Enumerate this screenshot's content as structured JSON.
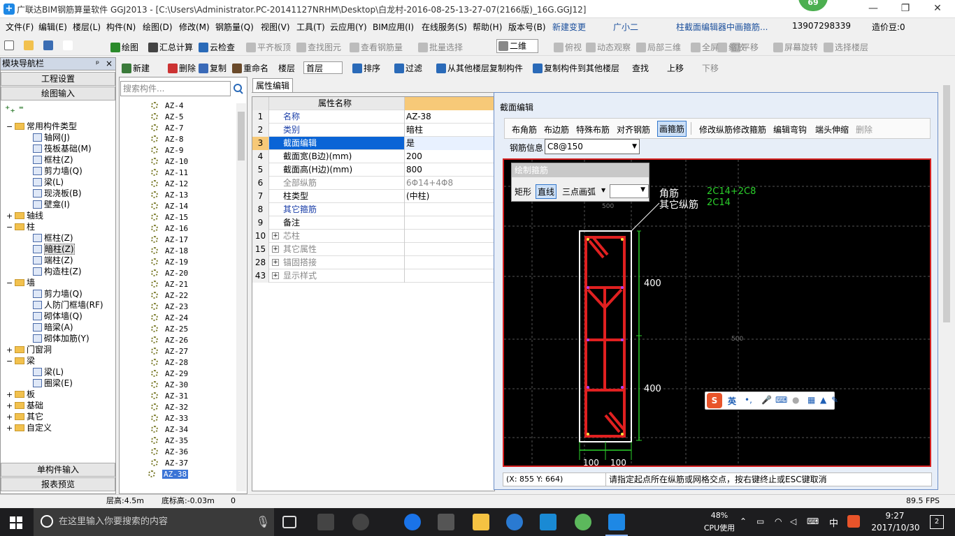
{
  "app": {
    "title": "广联达BIM钢筋算量软件 GGJ2013 - [C:\\Users\\Administrator.PC-20141127NRHM\\Desktop\\白龙村-2016-08-25-13-27-07(2166版)_16G.GGJ12]",
    "badge": "69"
  },
  "menu": {
    "items": [
      "文件(F)",
      "编辑(E)",
      "楼层(L)",
      "构件(N)",
      "绘图(D)",
      "修改(M)",
      "钢筋量(Q)",
      "视图(V)",
      "工具(T)",
      "云应用(Y)",
      "BIM应用(I)",
      "在线服务(S)",
      "帮助(H)",
      "版本号(B)",
      "新建变更",
      "广小二",
      "柱截面编辑器中画箍筋...",
      "13907298339",
      "造价豆:0"
    ]
  },
  "toolbar1": {
    "items": [
      "绘图",
      "汇总计算",
      "云检查",
      "平齐板顶",
      "查找图元",
      "查看钢筋量",
      "批量选择",
      "二维",
      "俯视",
      "动态观察",
      "局部三维",
      "全屏",
      "缩放",
      "平移",
      "屏幕旋转",
      "选择楼层"
    ]
  },
  "toolbar2": {
    "items": [
      "新建",
      "删除",
      "复制",
      "重命名",
      "楼层",
      "首层",
      "排序",
      "过滤",
      "从其他楼层复制构件",
      "复制构件到其他楼层",
      "查找",
      "上移",
      "下移"
    ]
  },
  "leftnav": {
    "header": "模块导航栏",
    "pin": "ᵖ",
    "close": "×",
    "btn_project": "工程设置",
    "btn_draw": "绘图输入",
    "btn_single": "单构件输入",
    "btn_report": "报表预览",
    "tree": [
      {
        "label": "常用构件类型",
        "level": 0,
        "type": "folder",
        "exp": "−"
      },
      {
        "label": "轴网(J)",
        "level": 1,
        "type": "item"
      },
      {
        "label": "筏板基础(M)",
        "level": 1,
        "type": "item"
      },
      {
        "label": "框柱(Z)",
        "level": 1,
        "type": "item"
      },
      {
        "label": "剪力墙(Q)",
        "level": 1,
        "type": "item"
      },
      {
        "label": "梁(L)",
        "level": 1,
        "type": "item"
      },
      {
        "label": "现浇板(B)",
        "level": 1,
        "type": "item"
      },
      {
        "label": "壁龛(I)",
        "level": 1,
        "type": "item"
      },
      {
        "label": "轴线",
        "level": 0,
        "type": "folder",
        "exp": "+"
      },
      {
        "label": "柱",
        "level": 0,
        "type": "folder",
        "exp": "−"
      },
      {
        "label": "框柱(Z)",
        "level": 1,
        "type": "item"
      },
      {
        "label": "暗柱(Z)",
        "level": 1,
        "type": "item"
      },
      {
        "label": "端柱(Z)",
        "level": 1,
        "type": "item"
      },
      {
        "label": "构造柱(Z)",
        "level": 1,
        "type": "item"
      },
      {
        "label": "墙",
        "level": 0,
        "type": "folder",
        "exp": "−"
      },
      {
        "label": "剪力墙(Q)",
        "level": 1,
        "type": "item"
      },
      {
        "label": "人防门框墙(RF)",
        "level": 1,
        "type": "item"
      },
      {
        "label": "砌体墙(Q)",
        "level": 1,
        "type": "item"
      },
      {
        "label": "暗梁(A)",
        "level": 1,
        "type": "item"
      },
      {
        "label": "砌体加筋(Y)",
        "level": 1,
        "type": "item"
      },
      {
        "label": "门窗洞",
        "level": 0,
        "type": "folder",
        "exp": "+"
      },
      {
        "label": "梁",
        "level": 0,
        "type": "folder",
        "exp": "−"
      },
      {
        "label": "梁(L)",
        "level": 1,
        "type": "item"
      },
      {
        "label": "圈梁(E)",
        "level": 1,
        "type": "item"
      },
      {
        "label": "板",
        "level": 0,
        "type": "folder",
        "exp": "+"
      },
      {
        "label": "基础",
        "level": 0,
        "type": "folder",
        "exp": "+"
      },
      {
        "label": "其它",
        "level": 0,
        "type": "folder",
        "exp": "+"
      },
      {
        "label": "自定义",
        "level": 0,
        "type": "folder",
        "exp": "+"
      }
    ]
  },
  "components": {
    "search_placeholder": "搜索构件...",
    "items": [
      "AZ-4",
      "AZ-5",
      "AZ-7",
      "AZ-8",
      "AZ-9",
      "AZ-10",
      "AZ-11",
      "AZ-12",
      "AZ-13",
      "AZ-14",
      "AZ-15",
      "AZ-16",
      "AZ-17",
      "AZ-18",
      "AZ-19",
      "AZ-20",
      "AZ-21",
      "AZ-22",
      "AZ-23",
      "AZ-24",
      "AZ-25",
      "AZ-26",
      "AZ-27",
      "AZ-28",
      "AZ-29",
      "AZ-30",
      "AZ-31",
      "AZ-32",
      "AZ-33",
      "AZ-34",
      "AZ-35",
      "AZ-36",
      "AZ-37",
      "AZ-38"
    ],
    "selected": "AZ-38"
  },
  "props": {
    "tab": "属性编辑",
    "header": "属性名称",
    "rows": [
      {
        "n": "1",
        "k": "名称",
        "v": "AZ-38",
        "blue": true
      },
      {
        "n": "2",
        "k": "类别",
        "v": "暗柱",
        "blue": true
      },
      {
        "n": "3",
        "k": "截面编辑",
        "v": "是",
        "blue": true,
        "sel": true
      },
      {
        "n": "4",
        "k": "截面宽(B边)(mm)",
        "v": "200"
      },
      {
        "n": "5",
        "k": "截面高(H边)(mm)",
        "v": "800"
      },
      {
        "n": "6",
        "k": "全部纵筋",
        "v": "6Φ14+4Φ8",
        "grey": true
      },
      {
        "n": "7",
        "k": "柱类型",
        "v": "(中柱)"
      },
      {
        "n": "8",
        "k": "其它箍筋",
        "v": "",
        "blue": true
      },
      {
        "n": "9",
        "k": "备注",
        "v": ""
      },
      {
        "n": "10",
        "k": "芯柱",
        "v": "",
        "grey": true,
        "plus": true
      },
      {
        "n": "15",
        "k": "其它属性",
        "v": "",
        "grey": true,
        "plus": true
      },
      {
        "n": "28",
        "k": "锚固搭接",
        "v": "",
        "grey": true,
        "plus": true
      },
      {
        "n": "43",
        "k": "显示样式",
        "v": "",
        "grey": true,
        "plus": true
      }
    ]
  },
  "section_editor": {
    "title": "截面编辑",
    "tools": [
      "布角筋",
      "布边筋",
      "特殊布筋",
      "对齐钢筋",
      "画箍筋",
      "修改纵筋",
      "修改箍筋",
      "编辑弯钩",
      "端头伸缩",
      "删除"
    ],
    "active_tool": "画箍筋",
    "rebar_label": "钢筋信息",
    "rebar_value": "C8@150",
    "draw_title": "绘制箍筋",
    "draw_modes": [
      "矩形",
      "直线",
      "三点画弧"
    ],
    "active_mode": "直线",
    "label_corner": "角筋",
    "label_other": "其它纵筋",
    "value_corner": "2C14+2C8",
    "value_other": "2C14",
    "dim_top": "400",
    "dim_bottom": "400",
    "dim_w1": "100",
    "dim_w2": "100",
    "grid_a": "500",
    "grid_b": "500",
    "coords": "(X: 855 Y: 664)",
    "hint": "请指定起点所在纵筋或网格交点，按右键终止或ESC键取消"
  },
  "ime": {
    "lang": "英"
  },
  "statusbar": {
    "floor_height": "层高:4.5m",
    "bottom_height": "底标高:-0.03m",
    "zero": "0",
    "fps": "89.5 FPS"
  },
  "taskbar": {
    "search_placeholder": "在这里输入你要搜索的内容",
    "cpu": "48%",
    "cpu_label": "CPU使用",
    "time": "9:27",
    "date": "2017/10/30",
    "ime": "中",
    "notif": "2"
  }
}
